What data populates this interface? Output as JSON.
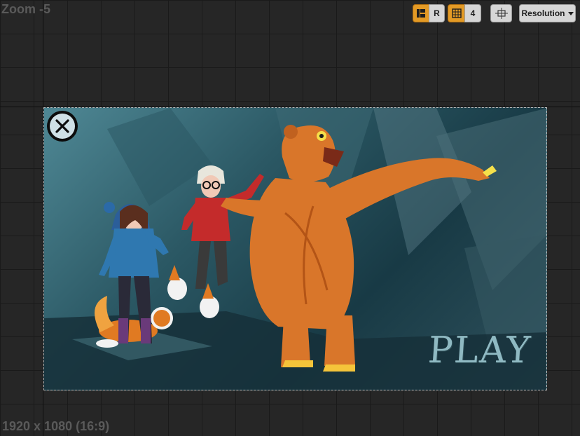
{
  "editor": {
    "zoom_label": "Zoom -5",
    "resolution_label": "1920 x 1080 (16:9)"
  },
  "toolbar": {
    "respect_locks_label": "R",
    "grid_snap_value": "4",
    "resolution_label": "Resolution",
    "colors": {
      "active": "#e39a25",
      "inactive": "#d6d6d6"
    }
  },
  "game": {
    "play_label": "PLAY",
    "close_icon": "close-icon",
    "colors": {
      "play_text": "#8fb9c2",
      "background": "#2b5864",
      "bear": "#d9762a"
    }
  }
}
